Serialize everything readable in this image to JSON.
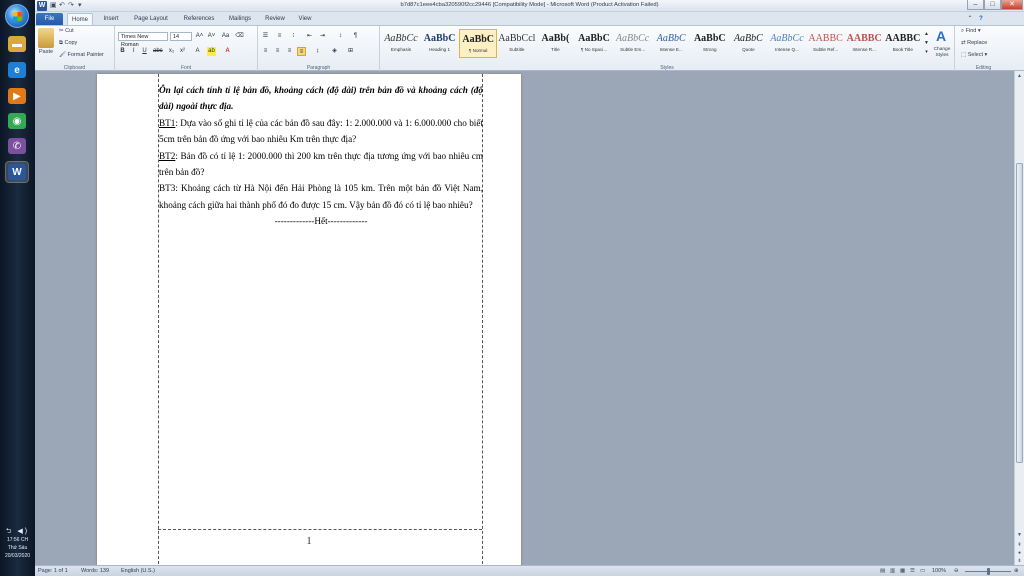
{
  "taskbar": {
    "apps": [
      {
        "name": "file-explorer-icon",
        "glyph": "▬",
        "color": "#d9a93b"
      },
      {
        "name": "internet-explorer-icon",
        "glyph": "e",
        "color": "#1e7fd6"
      },
      {
        "name": "media-player-icon",
        "glyph": "▶",
        "color": "#e07a19"
      },
      {
        "name": "chrome-icon",
        "glyph": "◉",
        "color": "#34a853"
      },
      {
        "name": "viber-icon",
        "glyph": "✆",
        "color": "#7b519d"
      },
      {
        "name": "word-icon",
        "glyph": "W",
        "color": "#2b579a"
      }
    ],
    "tray_icons": "⮌ ◀)",
    "time": "17:56 CH",
    "day": "Thứ Sáu",
    "date": "20/03/2020"
  },
  "window": {
    "title": "b7d87c1eee4cba320590f2cc29446 [Compatibility Mode] - Microsoft Word (Product Activation Failed)",
    "minimize": "–",
    "maximize": "□",
    "close": "✕"
  },
  "tabs": [
    "File",
    "Home",
    "Insert",
    "Page Layout",
    "References",
    "Mailings",
    "Review",
    "View"
  ],
  "ribbon": {
    "clipboard": {
      "paste": "Paste",
      "cut": "Cut",
      "copy": "Copy",
      "format_painter": "Format Painter",
      "label": "Clipboard"
    },
    "font": {
      "family": "Times New Roman",
      "size": "14",
      "label": "Font"
    },
    "paragraph": {
      "label": "Paragraph"
    },
    "styles": {
      "label": "Styles",
      "items": [
        {
          "sample": "AaBbCc",
          "name": "Emphasis",
          "color": "#333",
          "italic": true
        },
        {
          "sample": "AaBbC",
          "name": "Heading 1",
          "color": "#1f3d6e",
          "bold": true
        },
        {
          "sample": "AaBbC",
          "name": "¶ Normal",
          "color": "#222",
          "bold": true
        },
        {
          "sample": "AaBbCcl",
          "name": "Subtitle",
          "color": "#333"
        },
        {
          "sample": "AaBb(",
          "name": "Title",
          "color": "#222",
          "bold": true
        },
        {
          "sample": "AaBbC",
          "name": "¶ No Spaci...",
          "color": "#222",
          "bold": true
        },
        {
          "sample": "AaBbCc",
          "name": "Subtle Em...",
          "color": "#888",
          "italic": true
        },
        {
          "sample": "AaBbC",
          "name": "Intense E...",
          "color": "#2f5e9e",
          "italic": true
        },
        {
          "sample": "AaBbC",
          "name": "Strong",
          "color": "#222",
          "bold": true
        },
        {
          "sample": "AaBbC",
          "name": "Quote",
          "color": "#222",
          "italic": true
        },
        {
          "sample": "AaBbCc",
          "name": "Intense Q...",
          "color": "#4f81bd",
          "italic": true
        },
        {
          "sample": "AABBC",
          "name": "Subtle Ref...",
          "color": "#c0504d"
        },
        {
          "sample": "AABBC",
          "name": "Intense R...",
          "color": "#c0504d",
          "bold": true
        },
        {
          "sample": "AABBC",
          "name": "Book Title",
          "color": "#222",
          "bold": true
        }
      ],
      "change_styles": "Change Styles"
    },
    "editing": {
      "find": "Find",
      "replace": "Replace",
      "select": "Select",
      "label": "Editing"
    }
  },
  "document": {
    "heading": "Ôn lại cách tính tỉ lệ bản đồ, khoảng cách (độ dài) trên bản đồ và khoảng cách (độ dài) ngoài thực địa.",
    "bt1_label": "BT1",
    "bt1_text": ": Dựa vào số ghi tỉ lệ của các bản đồ sau đây: 1: 2.000.000 và 1: 6.000.000 cho biết 5cm trên bản đồ ứng với bao nhiêu Km trên thực địa?",
    "bt2_label": "BT2",
    "bt2_text": ": Bản đồ có tỉ lệ 1: 2000.000 thì 200 km trên thực địa tương ứng với bao nhiêu cm trên bản đồ?",
    "bt3_text": "BT3: Khoảng cách từ Hà Nội đến Hải Phòng là 105 km. Trên một bản đồ Việt Nam, khoảng cách giữa hai thành phố đó đo được 15 cm. Vậy bản đồ đó có tỉ lệ bao nhiêu?",
    "end": "-------------Hết-------------",
    "page_number": "1"
  },
  "status": {
    "page": "Page: 1 of 1",
    "words": "Words: 139",
    "language": "English (U.S.)",
    "zoom": "100%",
    "zoom_level": 0.5
  }
}
